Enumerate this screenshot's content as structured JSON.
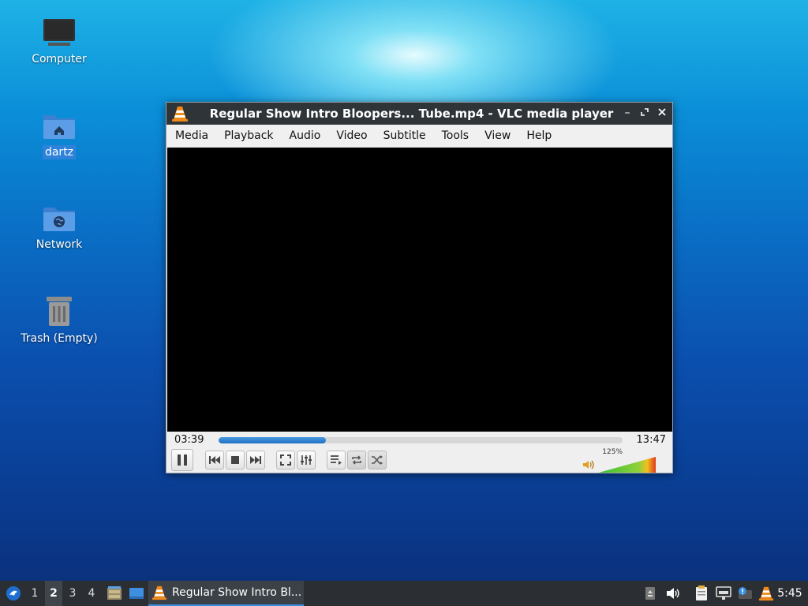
{
  "desktop": {
    "icons": [
      {
        "label": "Computer"
      },
      {
        "label": "dartz"
      },
      {
        "label": "Network"
      },
      {
        "label": "Trash (Empty)"
      }
    ]
  },
  "vlc": {
    "title": "Regular Show Intro Bloopers... Tube.mp4 - VLC media player",
    "menu": [
      "Media",
      "Playback",
      "Audio",
      "Video",
      "Subtitle",
      "Tools",
      "View",
      "Help"
    ],
    "elapsed": "03:39",
    "duration": "13:47",
    "progress_fraction": 0.265,
    "volume_label": "125%",
    "volume_fraction": 1.0
  },
  "taskbar": {
    "workspaces": [
      "1",
      "2",
      "3",
      "4"
    ],
    "active_workspace": "2",
    "task_label": "Regular Show Intro Bl...",
    "clock": "5:45"
  },
  "colors": {
    "accent": "#3b8fe0",
    "taskbar_bg": "#2b2f33",
    "vlc_orange": "#f08a1c"
  }
}
